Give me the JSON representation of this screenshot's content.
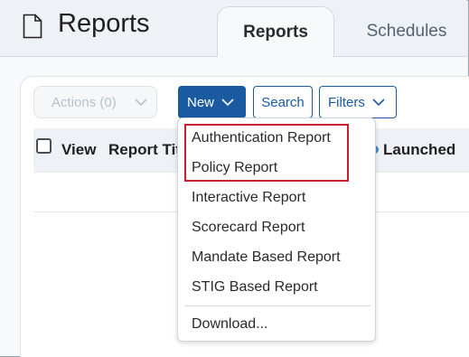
{
  "header": {
    "title": "Reports",
    "icon": "document-icon",
    "tabs": [
      {
        "label": "Reports",
        "active": true
      },
      {
        "label": "Schedules",
        "active": false
      }
    ]
  },
  "toolbar": {
    "actions_label": "Actions (0)",
    "new_label": "New",
    "search_label": "Search",
    "filters_label": "Filters"
  },
  "table": {
    "columns": [
      "View",
      "Report Title",
      "Launched"
    ]
  },
  "new_menu": {
    "items": [
      "Authentication Report",
      "Policy Report",
      "Interactive Report",
      "Scorecard Report",
      "Mandate Based Report",
      "STIG Based Report"
    ],
    "download_label": "Download..."
  },
  "colors": {
    "primary": "#1a5aa0",
    "highlight": "#c8202a"
  }
}
